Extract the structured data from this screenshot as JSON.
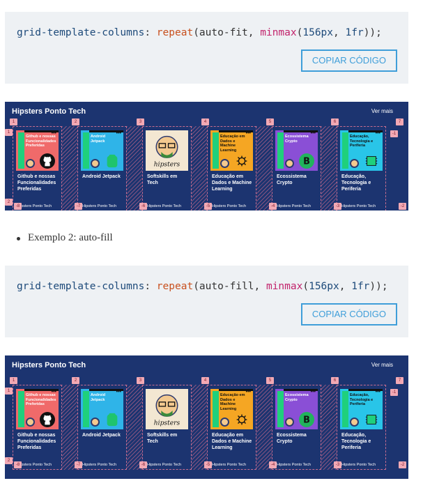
{
  "code1": {
    "prop": "grid-template-columns",
    "fn": "repeat",
    "kw": "auto-fit",
    "fn2": "minmax",
    "a": "156px",
    "b": "1fr",
    "copy_label": "COPIAR CÓDIGO"
  },
  "code2": {
    "prop": "grid-template-columns",
    "fn": "repeat",
    "kw": "auto-fill",
    "fn2": "minmax",
    "a": "156px",
    "b": "1fr",
    "copy_label": "COPIAR CÓDIGO"
  },
  "bullet": "Exemplo 2: auto-fill",
  "panel1": {
    "title": "Hipsters Ponto Tech",
    "more": "Ver mais",
    "top_numbers": [
      "1",
      "2",
      "3",
      "4",
      "5",
      "6",
      "7",
      "8",
      "-1"
    ],
    "bottom_numbers": [
      "-8",
      "-7",
      "-6",
      "-5",
      "-4",
      "-3",
      "-2",
      "-1"
    ],
    "side_top": "1",
    "side_bottom": "2"
  },
  "panel2": {
    "title": "Hipsters Ponto Tech",
    "more": "Ver mais",
    "top_numbers": [
      "1",
      "2",
      "3",
      "4",
      "5",
      "6",
      "7",
      "8",
      "-1"
    ],
    "bottom_numbers": [
      "-8",
      "-7",
      "-6",
      "-5",
      "-4",
      "-3",
      "-2",
      "-1"
    ],
    "side_top": "1",
    "side_bottom": "2"
  },
  "episodes_panel1": [
    {
      "num": "#304",
      "thumb_title": "Github e nossas Funcionalidades Preferidas",
      "title": "Github e nossas Funcionalidades Preferidas",
      "sub": "Hipsters Ponto Tech",
      "bg": "#f06a6a",
      "icon": "github-icon"
    },
    {
      "num": "#303",
      "thumb_title": "Android Jetpack",
      "title": "Android Jetpack",
      "sub": "Hipsters Ponto Tech",
      "bg": "#2fb4e8",
      "icon": "jetpack-icon"
    },
    {
      "num": "",
      "thumb_title": "",
      "title": "Softskills em Tech",
      "sub": "Hipsters Ponto Tech",
      "bg": "#f3e7d2",
      "icon": "hipsters-logo"
    },
    {
      "num": "#301",
      "thumb_title": "Educação em Dados e Machine Learning",
      "title": "Educação em Dados e Machine Learning",
      "sub": "Hipsters Ponto Tech",
      "bg": "#f5a623",
      "icon": "brain-circuit-icon"
    },
    {
      "num": "#298",
      "thumb_title": "Ecossistema Crypto",
      "title": "Ecossistema Crypto",
      "sub": "Hipsters Ponto Tech",
      "bg": "#8a4fd6",
      "icon": "bitcoin-icon"
    },
    {
      "num": "#299",
      "thumb_title": "Educação, Tecnologia e Periferia",
      "title": "Educação, Tecnologia e Periferia",
      "sub": "Hipsters Ponto Tech",
      "bg": "#29c5e8",
      "icon": "chip-icon"
    }
  ],
  "episodes_panel2": [
    {
      "num": "#304",
      "thumb_title": "Github e nossas Funcionalidades Preferidas",
      "title": "Github e nossas Funcionalidades Preferidas",
      "sub": "Hipsters Ponto Tech",
      "bg": "#f06a6a",
      "icon": "github-icon"
    },
    {
      "num": "#303",
      "thumb_title": "Android Jetpack",
      "title": "Android Jetpack",
      "sub": "Hipsters Ponto Tech",
      "bg": "#2fb4e8",
      "icon": "jetpack-icon"
    },
    {
      "num": "",
      "thumb_title": "",
      "title": "Softskills em Tech",
      "sub": "Hipsters Ponto Tech",
      "bg": "#f3e7d2",
      "icon": "hipsters-logo"
    },
    {
      "num": "#301",
      "thumb_title": "Educação em Dados e Machine Learning",
      "title": "Educação em Dados e Machine Learning",
      "sub": "Hipsters Ponto Tech",
      "bg": "#f5a623",
      "icon": "brain-circuit-icon"
    },
    {
      "num": "#298",
      "thumb_title": "Ecossistema Crypto",
      "title": "Ecossistema Crypto",
      "sub": "Hipsters Ponto Tech",
      "bg": "#8a4fd6",
      "icon": "bitcoin-icon"
    },
    {
      "num": "#299",
      "thumb_title": "Educação, Tecnologia e Periferia",
      "title": "Educação, Tecnologia e Periferia",
      "sub": "Hipsters Ponto Tech",
      "bg": "#29c5e8",
      "icon": "chip-icon"
    }
  ],
  "colors": {
    "panel_bg": "#1c3470",
    "accent": "#3f9ed9",
    "code_bg": "#eef1f4"
  }
}
